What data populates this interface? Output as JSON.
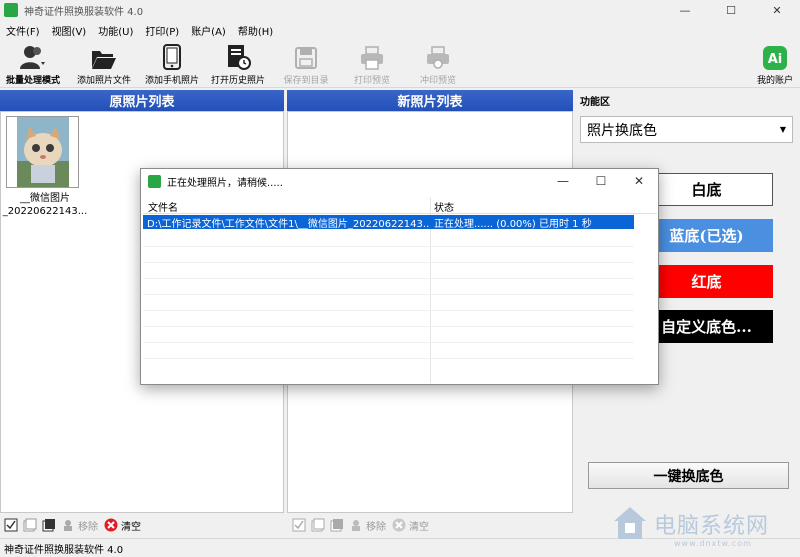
{
  "window": {
    "title": "神奇证件照换服装软件 4.0",
    "app_icon_label": "神奇证件",
    "min": "—",
    "max": "☐",
    "close": "✕"
  },
  "menu": [
    "文件(F)",
    "视图(V)",
    "功能(U)",
    "打印(P)",
    "账户(A)",
    "帮助(H)"
  ],
  "toolbar": {
    "batch": "批量处理模式",
    "add_photo": "添加照片文件",
    "add_phone": "添加手机照片",
    "open_history": "打开历史照片",
    "save_dir": "保存到目录",
    "print_preview": "打印预览",
    "stamp_preview": "冲印预览",
    "account": "我的账户"
  },
  "left_panel": {
    "header": "原照片列表",
    "thumb_caption_1": "__微信图片",
    "thumb_caption_2": "_20220622143..."
  },
  "center_panel": {
    "header": "新照片列表"
  },
  "footer": {
    "remove": "移除",
    "clear": "清空"
  },
  "function_area": {
    "label": "功能区",
    "select_value": "照片换底色",
    "white": "白底",
    "blue": "蓝底(已选)",
    "red": "红底",
    "custom": "自定义底色...",
    "one_key": "一键换底色",
    "colors": {
      "white": "#ffffff",
      "blue": "#4a8fe0",
      "red": "#ff0000",
      "black": "#000000"
    }
  },
  "dialog": {
    "title": "正在处理照片，请稍候.....",
    "col_filename": "文件名",
    "col_status": "状态",
    "row_filename": "D:\\工作记录文件\\工作文件\\文件1\\__微信图片_20220622143...",
    "row_status": "正在处理...... (0.00%) 已用时 1 秒"
  },
  "statusbar": "神奇证件照换服装软件 4.0",
  "watermark": {
    "text": "电脑系统网",
    "sub": "www.dnxtw.com"
  }
}
